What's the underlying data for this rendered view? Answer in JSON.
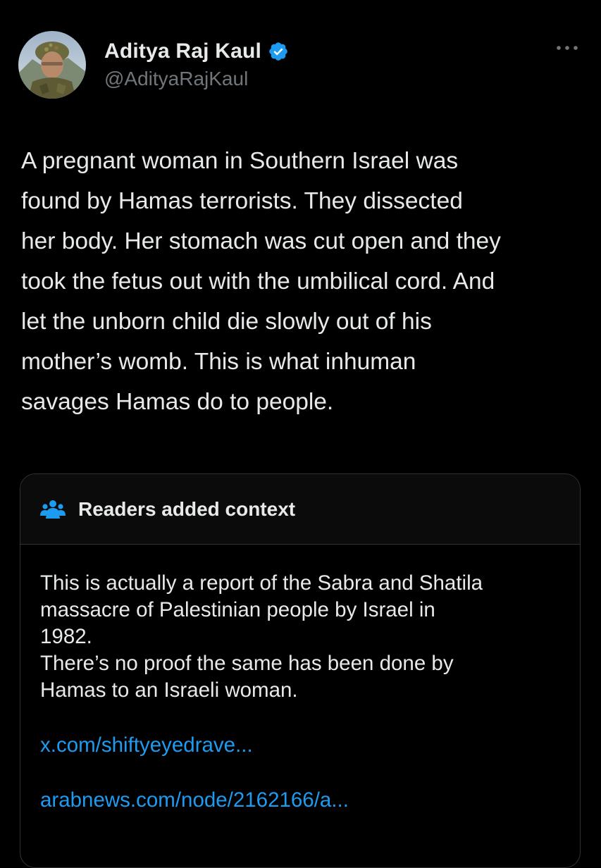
{
  "author": {
    "display_name": "Aditya Raj Kaul",
    "handle": "@AdityaRajKaul",
    "avatar_icon": "avatar-soldier-photo",
    "verified_icon": "verified-badge-icon",
    "verified_color": "#1d9bf0"
  },
  "tweet": {
    "text": "A pregnant woman in Southern Israel was\nfound by Hamas terrorists. They dissected\nher body. Her stomach was cut open and they\ntook the fetus out with the umbilical cord. And\nlet the unborn child die slowly out of his\nmother’s womb. This is what inhuman\nsavages Hamas do to people."
  },
  "more_menu": {
    "icon": "more-dots-icon"
  },
  "community_note": {
    "icon": "people-icon",
    "title": "Readers added context",
    "text": "This is actually a report of the Sabra and Shatila\nmassacre of Palestinian people by Israel in\n1982.\nThere’s no proof the same has been done by\nHamas to an Israeli woman.",
    "links": [
      "x.com/shiftyeyedrave...",
      "arabnews.com/node/2162166/a..."
    ],
    "link_color": "#1d9bf0"
  },
  "colors": {
    "background": "#000000",
    "text_primary": "#e7e9ea",
    "text_secondary": "#71767b",
    "border": "#2f3336"
  }
}
